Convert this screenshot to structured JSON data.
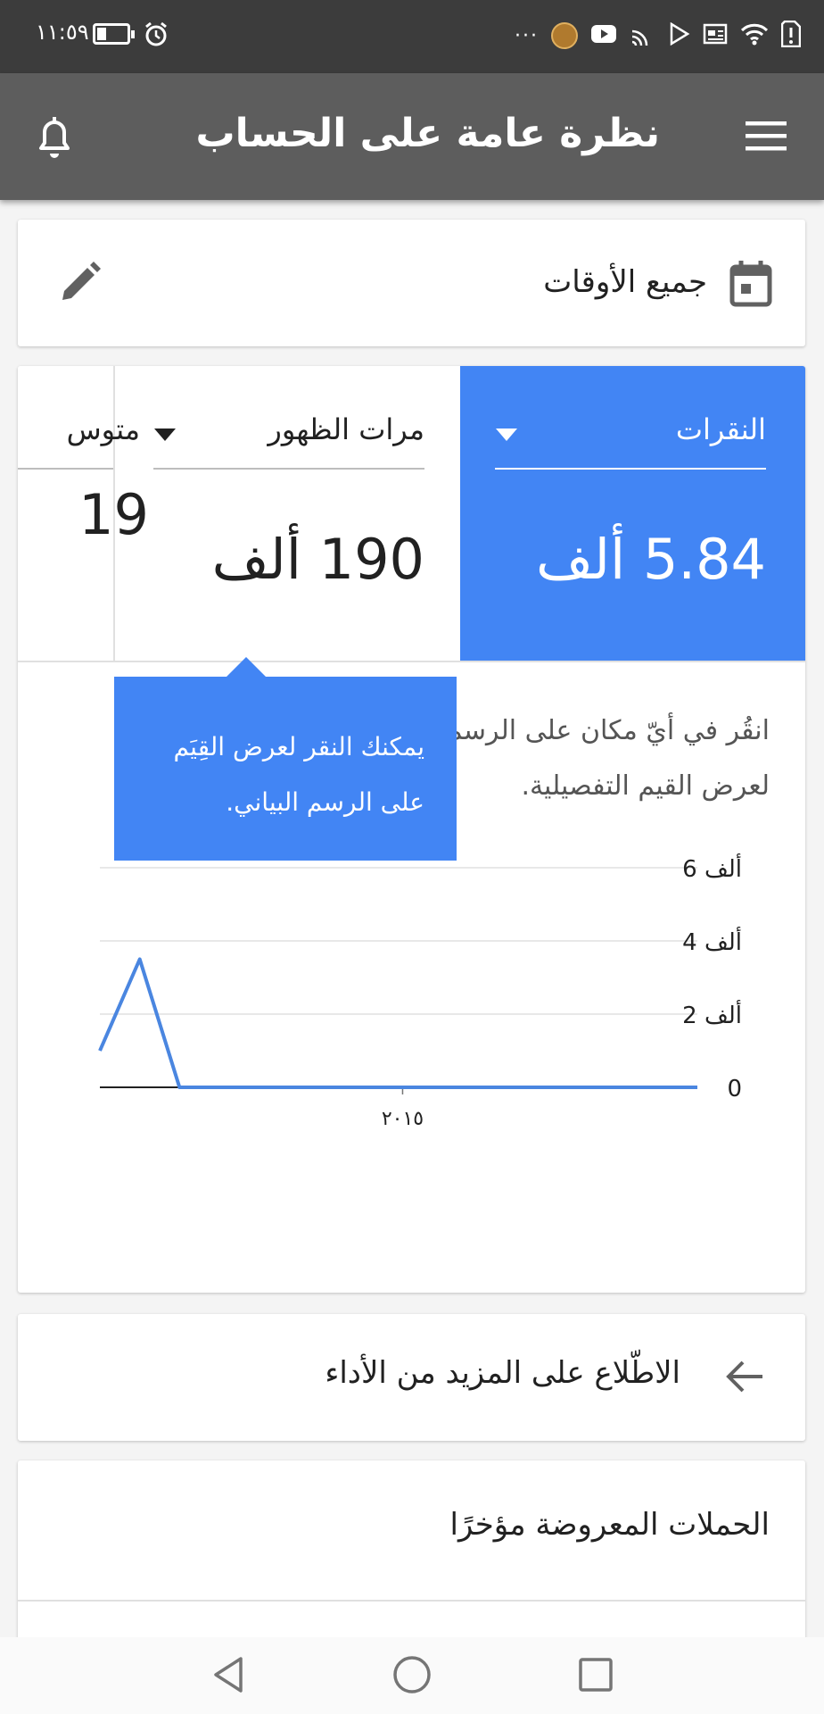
{
  "status_bar": {
    "time": "١١:٥٩",
    "dots": "···",
    "icons": [
      "battery-icon",
      "alarm-icon",
      "app-notification-icon",
      "youtube-icon",
      "cast-icon",
      "play-store-icon",
      "news-icon",
      "wifi-icon",
      "alert-icon"
    ]
  },
  "app_bar": {
    "title": "نظرة عامة على الحساب",
    "icons": [
      "menu-icon",
      "bell-icon"
    ]
  },
  "date_range": {
    "label": "جميع الأوقات",
    "icons": [
      "calendar-icon",
      "edit-icon"
    ]
  },
  "metrics": {
    "clicks": {
      "label": "النقرات",
      "value": "5.84 ألف"
    },
    "impressions": {
      "label": "مرات الظهور",
      "value": "190 ألف"
    },
    "average": {
      "label": "متوس",
      "value": "19"
    }
  },
  "hint_text": "انقُر في أيّ مكان على الرسم البياني لعرض القيم التفصيلية.",
  "tooltip": {
    "text": "يمكنك النقر لعرض القِيَم على الرسم البياني."
  },
  "chart_data": {
    "type": "line",
    "series": [
      {
        "values": [
          1000,
          3500,
          0,
          0,
          0,
          0,
          0,
          0,
          0,
          0,
          0,
          0,
          0,
          0,
          0,
          0
        ]
      }
    ],
    "y_tick_labels": [
      "0",
      "2 ألف",
      "4 ألف",
      "6 ألف"
    ],
    "y_tick_values": [
      0,
      2000,
      4000,
      6000
    ],
    "x_tick_labels": [
      "٢٠١٥"
    ],
    "x_tick_index": 7.6,
    "ylim": [
      0,
      6000
    ],
    "grid": true,
    "colors": {
      "line": "#4a86e0",
      "grid": "#e0e0e0",
      "axis": "#212121"
    }
  },
  "more_performance": {
    "label": "الاطّلاع على المزيد من الأداء",
    "icon": "arrow-left-icon"
  },
  "recent_campaigns": {
    "label": "الحملات المعروضة مؤخرًا"
  },
  "nav_bar": {
    "icons": [
      "back-icon",
      "home-icon",
      "recents-icon"
    ]
  },
  "colors": {
    "accent": "#4285f4",
    "app_bar": "#5d5d5d",
    "status_bar": "#3c3c3c"
  }
}
